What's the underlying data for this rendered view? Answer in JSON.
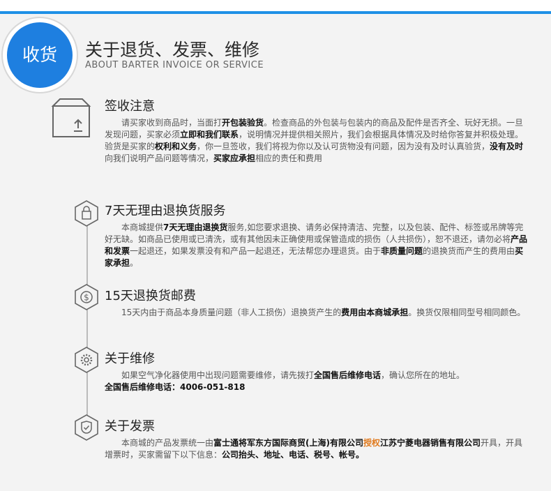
{
  "header": {
    "badge": "收货",
    "title": "关于退货、发票、维修",
    "subtitle": "ABOUT BARTER INVOICE OR SERVICE"
  },
  "sections": [
    {
      "title": "签收注意",
      "icon": "package-icon",
      "body": [
        {
          "t": "请买家收到商品时，当面打"
        },
        {
          "t": "开包装验货",
          "b": true
        },
        {
          "t": "。检查商品的外包装与包装内的商品及配件是否齐全、玩好无损。一旦发现问题，买家必须"
        },
        {
          "t": "立即和我们联系",
          "b": true
        },
        {
          "t": "，说明情况并提供相关照片，我们会根据具体情况及时给你答复并积极处理。验货是买家的"
        },
        {
          "t": "权利和义务",
          "b": true
        },
        {
          "t": "，你一旦签收，我们将视为你以及认可货物没有问题，因为没有及时认真验货，"
        },
        {
          "t": "没有及时",
          "b": true
        },
        {
          "t": "向我们说明产品问题等情况，"
        },
        {
          "t": "买家应承担",
          "b": true
        },
        {
          "t": "相应的责任和费用"
        }
      ]
    },
    {
      "title": "7天无理由退换货服务",
      "icon": "shopping-bag-icon",
      "body": [
        {
          "t": "本商城提供"
        },
        {
          "t": "7天无理由退换货",
          "b": true
        },
        {
          "t": "服务,如您要求退换、请务必保持清洁、完整，以及包装、配件、标签或吊牌等完好无缺。如商品已使用或已清洗，或有其他因未正确使用或保管造成的损伤（人共损伤），恕不退还，请勿必将"
        },
        {
          "t": "产品和发票",
          "b": true
        },
        {
          "t": "一起退还，如果发票没有和产品一起退还，无法帮您办理退货。由于"
        },
        {
          "t": "非质量问题",
          "b": true
        },
        {
          "t": "的退换货而产生的费用由"
        },
        {
          "t": "买家承担",
          "b": true
        },
        {
          "t": "。"
        }
      ]
    },
    {
      "title": "15天退换货邮费",
      "icon": "dollar-coin-icon",
      "body": [
        {
          "t": "15天内由于商品本身质量问题（非人工损伤）退换货产生的"
        },
        {
          "t": "费用由本商城承担",
          "b": true
        },
        {
          "t": "。换货仅限相同型号相同颜色。"
        }
      ]
    },
    {
      "title": "关于维修",
      "icon": "gear-icon",
      "body": [
        {
          "t": "如果空气净化器使用中出现问题需要维修，请先拨打"
        },
        {
          "t": "全国售后维修电话",
          "b": true
        },
        {
          "t": "，确认您所在的地址。"
        }
      ],
      "line2": "全国售后维修电话：4006-051-818"
    },
    {
      "title": "关于发票",
      "icon": "shield-check-icon",
      "body": [
        {
          "t": "本商城的产品发票统一由"
        },
        {
          "t": "富士通将军东方国际商贸(上海)有限公司",
          "b": true
        },
        {
          "t": "授权",
          "o": true
        },
        {
          "t": "江苏宁菱电器销售有限公司",
          "b": true
        },
        {
          "t": "开具，开具增票时，买家需留下以下信息："
        },
        {
          "t": "公司抬头、地址、电话、税号、帐号。",
          "b": true
        }
      ]
    }
  ],
  "colors": {
    "accent": "#1e7fe0",
    "highlight": "#e07a1e"
  }
}
